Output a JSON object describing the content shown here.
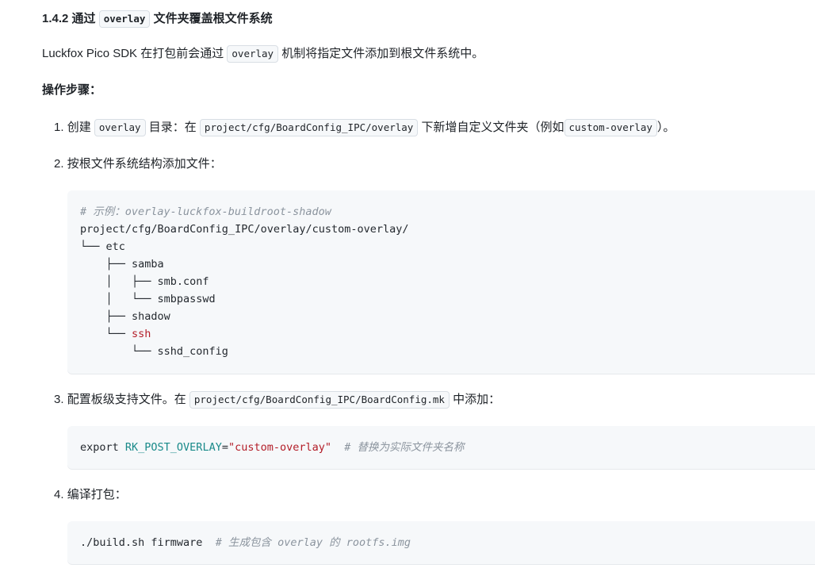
{
  "section": {
    "number": "1.4.2",
    "title_pre": "通过",
    "title_code": "overlay",
    "title_post": "文件夹覆盖根文件系统"
  },
  "intro": {
    "pre": "Luckfox Pico SDK 在打包前会通过",
    "code": "overlay",
    "post": "机制将指定文件添加到根文件系统中。"
  },
  "steps_heading": "操作步骤：",
  "step1": {
    "num": "1.",
    "pre": "创建",
    "code1": "overlay",
    "mid": "目录：在",
    "code2": "project/cfg/BoardConfig_IPC/overlay",
    "mid2": "下新增自定义文件夹（例如",
    "code3": "custom-overlay",
    "post": "）。"
  },
  "step2": {
    "num": "2.",
    "text": "按根文件系统结构添加文件："
  },
  "tree": {
    "comment": "# 示例：overlay-luckfox-buildroot-shadow",
    "lines": [
      "project/cfg/BoardConfig_IPC/overlay/custom-overlay/",
      "└── etc",
      "    ├── samba",
      "    │   ├── smb.conf",
      "    │   └── smbpasswd",
      "    ├── shadow",
      "    └── ",
      "        └── sshd_config"
    ],
    "ssh": "ssh"
  },
  "step3": {
    "num": "3.",
    "pre": "配置板级支持文件。在",
    "code": "project/cfg/BoardConfig_IPC/BoardConfig.mk",
    "post": "中添加："
  },
  "export_block": {
    "kw": "export ",
    "var": "RK_POST_OVERLAY",
    "eq": "=",
    "val": "\"custom-overlay\"",
    "comment": "  # 替换为实际文件夹名称"
  },
  "step4": {
    "num": "4.",
    "text": "编译打包："
  },
  "build_block": {
    "cmd": "./build.sh firmware",
    "comment": "  # 生成包含 overlay 的 rootfs.img"
  }
}
